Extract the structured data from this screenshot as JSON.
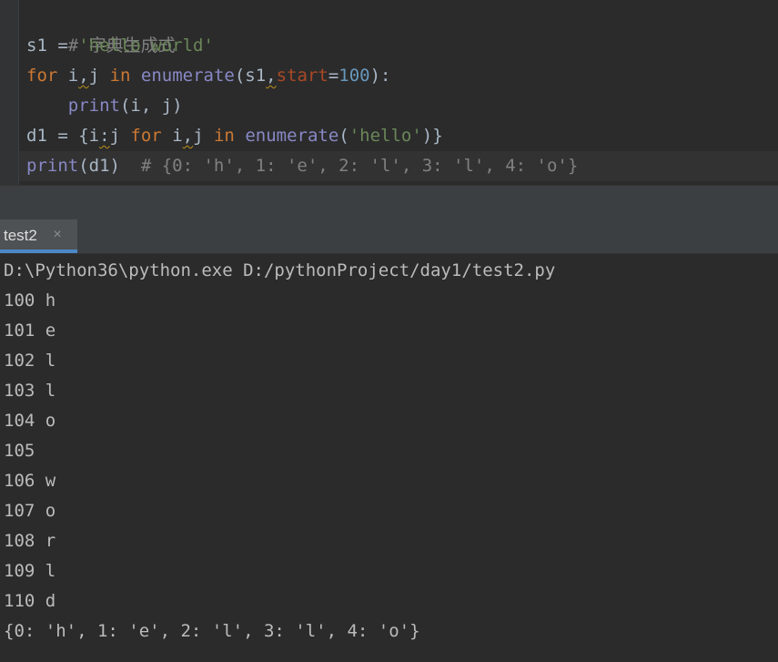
{
  "editor": {
    "comment_line": "# 字典生成式",
    "line2": {
      "var": "s1 = ",
      "str": "'hello world'"
    },
    "line3": {
      "kw_for": "for",
      "i": " i",
      "comma": ",",
      "j": "j ",
      "kw_in": "in",
      "func": " enumerate",
      "open": "(s1",
      "comma2": ",",
      "param": "start",
      "eq": "=",
      "num": "100",
      "close": "):"
    },
    "line4": {
      "indent": "    ",
      "func": "print",
      "args": "(i, j)"
    },
    "line5": {
      "lead": "d1 = {i",
      "colon": ":",
      "j": "j ",
      "kw_for": "for",
      "i": " i",
      "comma": ",",
      "j2": "j ",
      "kw_in": "in",
      "func": " enumerate",
      "open": "(",
      "str": "'hello'",
      "close": ")}"
    },
    "line6": {
      "func": "print",
      "args": "(d1)",
      "comment": "  # {0: 'h', 1: 'e', 2: 'l', 3: 'l', 4: 'o'}"
    }
  },
  "run_panel": {
    "tab_label": "test2",
    "close_glyph": "×"
  },
  "console": {
    "lines": [
      "D:\\Python36\\python.exe D:/pythonProject/day1/test2.py",
      "100 h",
      "101 e",
      "102 l",
      "103 l",
      "104 o",
      "105  ",
      "106 w",
      "107 o",
      "108 r",
      "109 l",
      "110 d",
      "{0: 'h', 1: 'e', 2: 'l', 3: 'l', 4: 'o'}"
    ]
  },
  "colors": {
    "background": "#2b2b2b",
    "keyword": "#cc7832",
    "builtin": "#8888c6",
    "string": "#6a8759",
    "number": "#6897bb",
    "comment": "#808080",
    "tab_indicator": "#4a88c7"
  }
}
